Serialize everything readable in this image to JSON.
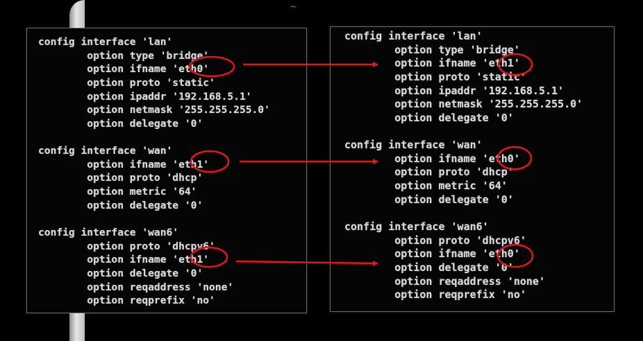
{
  "left_panel": {
    "lines": [
      "config interface 'lan'",
      "        option type 'bridge'",
      "        option ifname 'eth0'",
      "        option proto 'static'",
      "        option ipaddr '192.168.5.1'",
      "        option netmask '255.255.255.0'",
      "        option delegate '0'",
      "",
      "config interface 'wan'",
      "        option ifname 'eth1'",
      "        option proto 'dhcp'",
      "        option metric '64'",
      "        option delegate '0'",
      "",
      "config interface 'wan6'",
      "        option proto 'dhcpv6'",
      "        option ifname 'eth1'",
      "        option delegate '0'",
      "        option reqaddress 'none'",
      "        option reqprefix 'no'"
    ]
  },
  "right_panel": {
    "lines": [
      "config interface 'lan'",
      "        option type 'bridge'",
      "        option ifname 'eth1'",
      "        option proto 'static'",
      "        option ipaddr '192.168.5.1'",
      "        option netmask '255.255.255.0'",
      "        option delegate '0'",
      "",
      "config interface 'wan'",
      "        option ifname 'eth0'",
      "        option proto 'dhcp'",
      "        option metric '64'",
      "        option delegate '0'",
      "",
      "config interface 'wan6'",
      "        option proto 'dhcpv6'",
      "        option ifname 'eth0'",
      "        option delegate '0'",
      "        option reqaddress 'none'",
      "        option reqprefix 'no'"
    ]
  },
  "annotation_color": "#e8141b"
}
